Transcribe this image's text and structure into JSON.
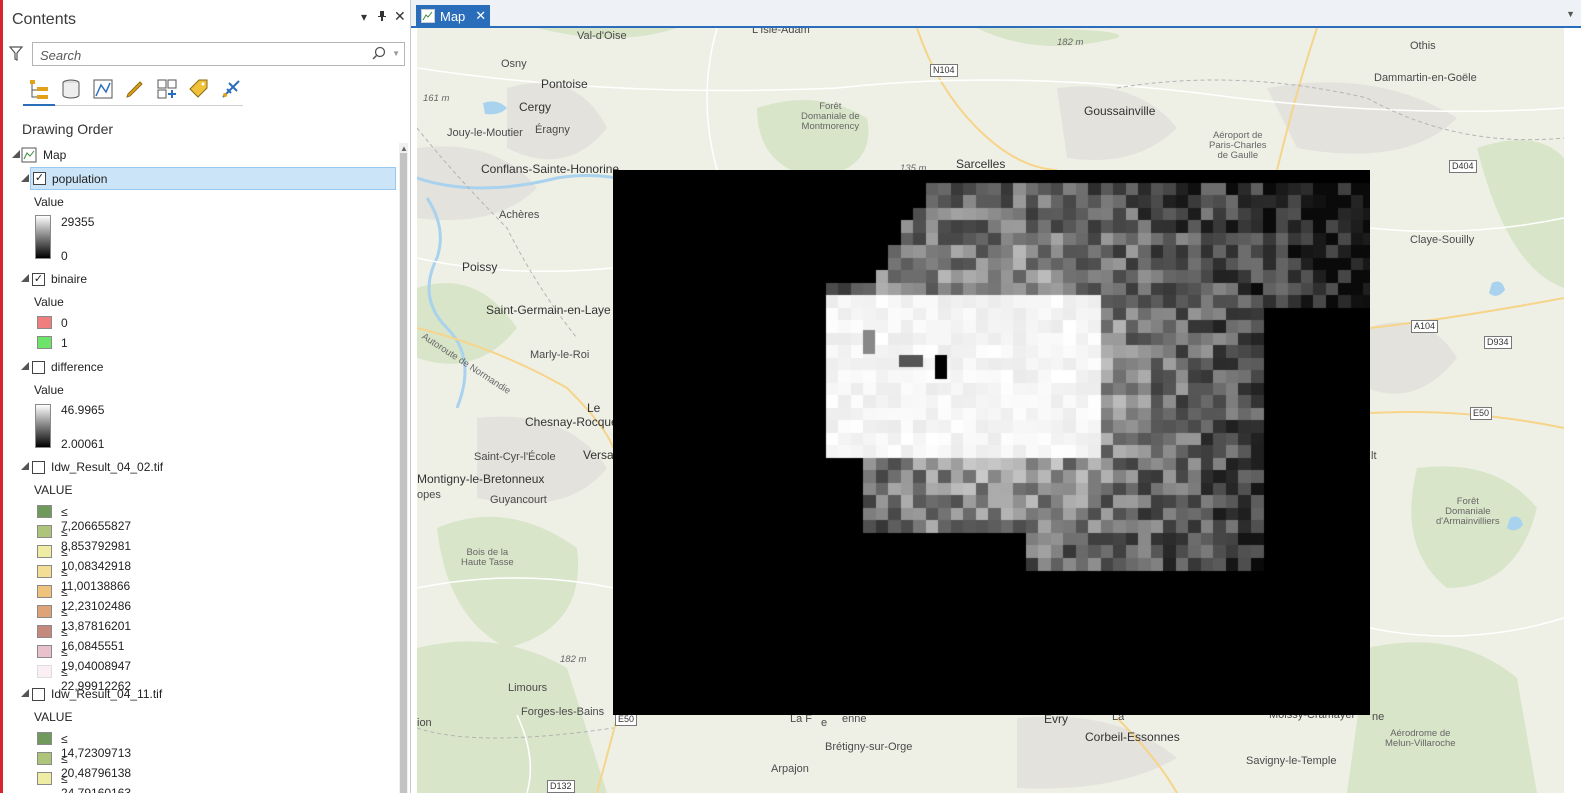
{
  "contents": {
    "title": "Contents",
    "search_placeholder": "Search",
    "section_title": "Drawing Order",
    "toolbar_icons": [
      "list-by-drawing-order-icon",
      "list-by-data-source-icon",
      "list-by-selection-icon",
      "list-by-editing-icon",
      "list-by-snapping-icon",
      "list-by-labeling-icon",
      "list-by-perspective-imagery-icon"
    ],
    "map_label": "Map",
    "layers": {
      "population": {
        "name": "population",
        "checked": true,
        "value_label": "Value",
        "max": "29355",
        "min": "0"
      },
      "binaire": {
        "name": "binaire",
        "checked": true,
        "value_label": "Value",
        "classes": [
          {
            "label": "0",
            "color": "#f07e7e"
          },
          {
            "label": "1",
            "color": "#6ee36a"
          }
        ]
      },
      "difference": {
        "name": "difference",
        "checked": false,
        "value_label": "Value",
        "max": "46.9965",
        "min": "2.00061"
      },
      "idw1": {
        "name": "Idw_Result_04_02.tif",
        "checked": false,
        "value_label": "VALUE",
        "classes": [
          {
            "label": "≤ 7,206655827",
            "color": "#6f9a5b"
          },
          {
            "label": "≤ 8,853792981",
            "color": "#adc47a"
          },
          {
            "label": "≤ 10,08342918",
            "color": "#efeca3"
          },
          {
            "label": "≤ 11,00138866",
            "color": "#f4dd95"
          },
          {
            "label": "≤ 12,23102486",
            "color": "#f0c37c"
          },
          {
            "label": "≤ 13,87816201",
            "color": "#dea377"
          },
          {
            "label": "≤ 16,0845551",
            "color": "#c4897c"
          },
          {
            "label": "≤ 19,04008947",
            "color": "#e8c1cc"
          },
          {
            "label": "≤ 22,99912262",
            "color": "#fbeff6"
          }
        ]
      },
      "idw2": {
        "name": "Idw_Result_04_11.tif",
        "checked": false,
        "value_label": "VALUE",
        "classes": [
          {
            "label": "≤ 14,72309713",
            "color": "#6f9a5b"
          },
          {
            "label": "≤ 20,48796138",
            "color": "#adc47a"
          },
          {
            "label": "≤ 24,79160163",
            "color": "#efeca3"
          }
        ]
      }
    }
  },
  "map_view": {
    "tab_label": "Map",
    "places": {
      "valdoise": "Val-d'Oise",
      "lisle": "L'Isle-Adam",
      "osny": "Osny",
      "pontoise": "Pontoise",
      "cergy": "Cergy",
      "jouy": "Jouy-le-Moutier",
      "eragny": "Éragny",
      "conflans": "Conflans-Sainte-Honorine",
      "acheres": "Achères",
      "poissy": "Poissy",
      "stgermain": "Saint-Germain-en-Laye",
      "marly": "Marly-le-Roi",
      "le": "Le",
      "chesnay": "Chesnay-Rocquencourt",
      "stcyr": "Saint-Cyr-l'École",
      "versa": "Versa",
      "montigny": "Montigny-le-Bretonneux",
      "opes": "opes",
      "guyancourt": "Guyancourt",
      "bois": "Bois de la\nHaute Tasse",
      "limours": "Limours",
      "forges": "Forges-les-Bains",
      "ion": "ion",
      "foret1": "Forêt\nDomaniale de\nMontmorency",
      "sarcelles": "Sarcelles",
      "goussainville": "Goussainville",
      "aeroport": "Aéroport de\nParis-Charles\nde Gaulle",
      "othis": "Othis",
      "dammartin": "Dammartin-en-Goële",
      "claye": "Claye-Souilly",
      "lt": "lt",
      "foret2": "Forêt\nDomaniale\nd'Armainvilliers",
      "evry": "Évry",
      "corbeil": "Corbeil-Essonnes",
      "bretigny": "Brétigny-sur-Orge",
      "arpajon": "Arpajon",
      "savigny": "Savigny-le-Temple",
      "moissy": "Moissy-Cramayel",
      "aerodrome": "Aérodrome de\nMelun-Villaroche",
      "enne": "enne",
      "lafe": "La F",
      "la": "La",
      "e": "e",
      "ne": "ne",
      "autoroute": "Autoroute de Normandie",
      "e161": "161 m",
      "e182a": "182 m",
      "e182b": "182 m",
      "e135": "135 m"
    },
    "roads": {
      "n104": "N104",
      "d404": "D404",
      "a104": "A104",
      "d934": "D934",
      "e50a": "E50",
      "e50b": "E50",
      "d132": "D132"
    }
  }
}
